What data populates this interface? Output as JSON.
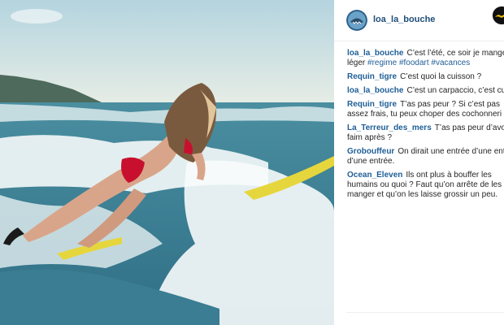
{
  "post": {
    "username": "loa_la_bouche",
    "image_alt": "surfer",
    "accent_color": "#1f5e96"
  },
  "comments": [
    {
      "user": "loa_la_bouche",
      "text": "C’est l’été, ce soir je mange léger ",
      "tags": [
        "#regime",
        "#foodart",
        "#vacances"
      ]
    },
    {
      "user": "Requin_tigre",
      "text": "C’est quoi la cuisson ?"
    },
    {
      "user": "loa_la_bouche",
      "text": "C’est un carpaccio, c’est cu"
    },
    {
      "user": "Requin_tigre",
      "text": "T’as pas peur ? Si c’est pas assez frais, tu peux choper des cochonneri"
    },
    {
      "user": "La_Terreur_des_mers",
      "text": "T’as pas peur d’avo faim après ?"
    },
    {
      "user": "Grobouffeur",
      "text": "On dirait une entrée d’une entrée d’une entrée."
    },
    {
      "user": "Ocean_Eleven",
      "text": "Ils ont plus à bouffer les humains ou quoi ? Faut qu’on arrête de les manger et qu’on les laisse grossir un peu."
    }
  ]
}
